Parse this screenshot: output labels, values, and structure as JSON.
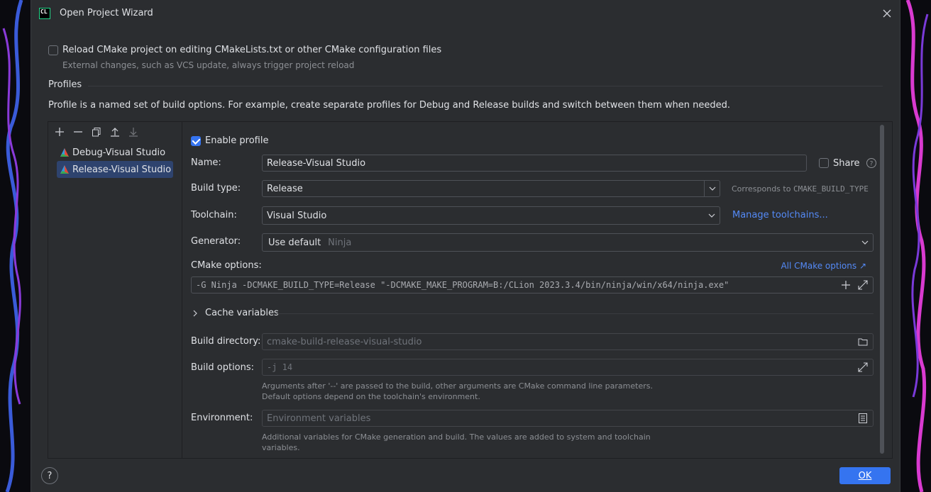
{
  "window": {
    "title": "Open Project Wizard",
    "logo_text": "CL"
  },
  "reload": {
    "label": "Reload CMake project on editing CMakeLists.txt or other CMake configuration files",
    "checked": false,
    "hint": "External changes, such as VCS update, always trigger project reload"
  },
  "profiles": {
    "title": "Profiles",
    "description": "Profile is a named set of build options. For example, create separate profiles for Debug and Release builds and switch between them when needed.",
    "items": [
      {
        "label": "Debug-Visual Studio",
        "selected": false
      },
      {
        "label": "Release-Visual Studio",
        "selected": true
      }
    ]
  },
  "form": {
    "enable_label": "Enable profile",
    "name_label": "Name:",
    "name_value": "Release-Visual Studio",
    "share_label": "Share",
    "build_type_label": "Build type:",
    "build_type_value": "Release",
    "build_type_hint_prefix": "Corresponds to ",
    "build_type_hint_code": "CMAKE_BUILD_TYPE",
    "toolchain_label": "Toolchain:",
    "toolchain_value": "Visual Studio",
    "manage_toolchains": "Manage toolchains...",
    "generator_label": "Generator:",
    "generator_value": "Use default",
    "generator_hint": "Ninja",
    "cmake_options_label": "CMake options:",
    "all_cmake_options": "All CMake options ↗",
    "cmake_options_value": "-G Ninja -DCMAKE_BUILD_TYPE=Release \"-DCMAKE_MAKE_PROGRAM=B:/CLion 2023.3.4/bin/ninja/win/x64/ninja.exe\"",
    "cache_variables_label": "Cache variables",
    "build_directory_label": "Build directory:",
    "build_directory_value": "cmake-build-release-visual-studio",
    "build_options_label": "Build options:",
    "build_options_value": "-j 14",
    "build_options_hint_1": "Arguments after '--' are passed to the build, other arguments are CMake command line parameters.",
    "build_options_hint_2": "Default options depend on the toolchain's environment.",
    "environment_label": "Environment:",
    "environment_placeholder": "Environment variables",
    "environment_hint_1": "Additional variables for CMake generation and build. The values are added to system and toolchain",
    "environment_hint_2": "variables."
  },
  "footer": {
    "help": "?",
    "ok": "OK"
  },
  "colors": {
    "accent": "#3574f0",
    "link": "#548af7",
    "background": "#2b2d30",
    "selection": "#2e436e"
  }
}
